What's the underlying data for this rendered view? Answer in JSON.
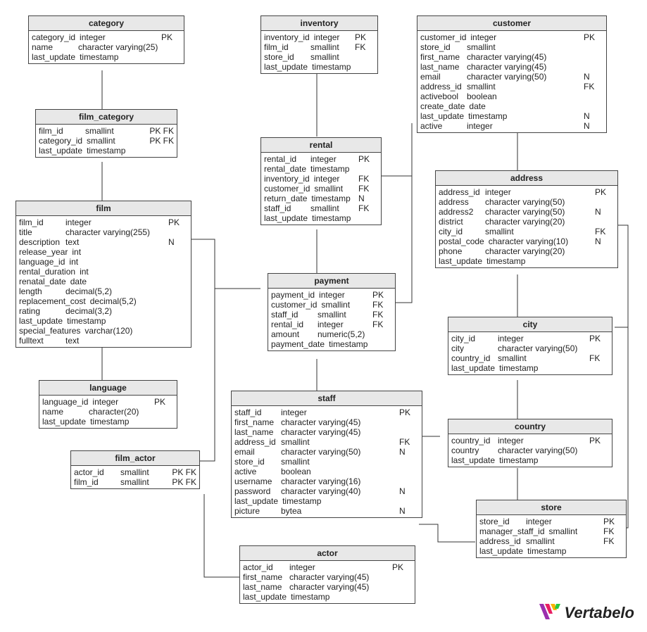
{
  "tables": {
    "category": {
      "title": "category",
      "cols": [
        {
          "n": "category_id",
          "t": "integer",
          "f": "PK"
        },
        {
          "n": "name",
          "t": "character varying(25)",
          "f": ""
        },
        {
          "n": "last_update",
          "t": "timestamp",
          "f": ""
        }
      ]
    },
    "film_category": {
      "title": "film_category",
      "cols": [
        {
          "n": "film_id",
          "t": "smallint",
          "f": "PK FK"
        },
        {
          "n": "category_id",
          "t": "smallint",
          "f": "PK FK"
        },
        {
          "n": "last_update",
          "t": "timestamp",
          "f": ""
        }
      ]
    },
    "film": {
      "title": "film",
      "cols": [
        {
          "n": "film_id",
          "t": "integer",
          "f": "PK"
        },
        {
          "n": "title",
          "t": "character varying(255)",
          "f": ""
        },
        {
          "n": "description",
          "t": "text",
          "f": "N"
        },
        {
          "n": "release_year",
          "t": "int",
          "f": ""
        },
        {
          "n": "language_id",
          "t": "int",
          "f": ""
        },
        {
          "n": "rental_duration",
          "t": "int",
          "f": ""
        },
        {
          "n": "renatal_date",
          "t": "date",
          "f": ""
        },
        {
          "n": "length",
          "t": "decimal(5,2)",
          "f": ""
        },
        {
          "n": "replacement_cost",
          "t": "decimal(5,2)",
          "f": ""
        },
        {
          "n": "rating",
          "t": "decimal(3,2)",
          "f": ""
        },
        {
          "n": "last_update",
          "t": "timestamp",
          "f": ""
        },
        {
          "n": "special_features",
          "t": "varchar(120)",
          "f": ""
        },
        {
          "n": "fulltext",
          "t": "text",
          "f": ""
        }
      ]
    },
    "language": {
      "title": "language",
      "cols": [
        {
          "n": "language_id",
          "t": "integer",
          "f": "PK"
        },
        {
          "n": "name",
          "t": "character(20)",
          "f": ""
        },
        {
          "n": "last_update",
          "t": "timestamp",
          "f": ""
        }
      ]
    },
    "film_actor": {
      "title": "film_actor",
      "cols": [
        {
          "n": "actor_id",
          "t": "smallint",
          "f": "PK FK"
        },
        {
          "n": "film_id",
          "t": "smallint",
          "f": "PK FK"
        }
      ]
    },
    "inventory": {
      "title": "inventory",
      "cols": [
        {
          "n": "inventory_id",
          "t": "integer",
          "f": "PK"
        },
        {
          "n": "film_id",
          "t": "smallint",
          "f": "FK"
        },
        {
          "n": "store_id",
          "t": "smallint",
          "f": ""
        },
        {
          "n": "last_update",
          "t": "timestamp",
          "f": ""
        }
      ]
    },
    "rental": {
      "title": "rental",
      "cols": [
        {
          "n": "rental_id",
          "t": "integer",
          "f": "PK"
        },
        {
          "n": "rental_date",
          "t": "timestamp",
          "f": ""
        },
        {
          "n": "inventory_id",
          "t": "integer",
          "f": "FK"
        },
        {
          "n": "customer_id",
          "t": "smallint",
          "f": "FK"
        },
        {
          "n": "return_date",
          "t": "timestamp",
          "f": "N"
        },
        {
          "n": "staff_id",
          "t": "smallint",
          "f": "FK"
        },
        {
          "n": "last_update",
          "t": "timestamp",
          "f": ""
        }
      ]
    },
    "payment": {
      "title": "payment",
      "cols": [
        {
          "n": "payment_id",
          "t": "integer",
          "f": "PK"
        },
        {
          "n": "customer_id",
          "t": "smallint",
          "f": "FK"
        },
        {
          "n": "staff_id",
          "t": "smallint",
          "f": "FK"
        },
        {
          "n": "rental_id",
          "t": "integer",
          "f": "FK"
        },
        {
          "n": "amount",
          "t": "numeric(5,2)",
          "f": ""
        },
        {
          "n": "payment_date",
          "t": "timestamp",
          "f": ""
        }
      ]
    },
    "staff": {
      "title": "staff",
      "cols": [
        {
          "n": "staff_id",
          "t": "integer",
          "f": "PK"
        },
        {
          "n": "first_name",
          "t": "character varying(45)",
          "f": ""
        },
        {
          "n": "last_name",
          "t": "character varying(45)",
          "f": ""
        },
        {
          "n": "address_id",
          "t": "smallint",
          "f": "FK"
        },
        {
          "n": "email",
          "t": "character varying(50)",
          "f": "N"
        },
        {
          "n": "store_id",
          "t": "smallint",
          "f": ""
        },
        {
          "n": "active",
          "t": "boolean",
          "f": ""
        },
        {
          "n": "username",
          "t": "character varying(16)",
          "f": ""
        },
        {
          "n": "password",
          "t": "character varying(40)",
          "f": "N"
        },
        {
          "n": "last_update",
          "t": "timestamp",
          "f": ""
        },
        {
          "n": "picture",
          "t": "bytea",
          "f": "N"
        }
      ]
    },
    "actor": {
      "title": "actor",
      "cols": [
        {
          "n": "actor_id",
          "t": "integer",
          "f": "PK"
        },
        {
          "n": "first_name",
          "t": "character varying(45)",
          "f": ""
        },
        {
          "n": "last_name",
          "t": "character varying(45)",
          "f": ""
        },
        {
          "n": "last_update",
          "t": "timestamp",
          "f": ""
        }
      ]
    },
    "customer": {
      "title": "customer",
      "cols": [
        {
          "n": "customer_id",
          "t": "integer",
          "f": "PK"
        },
        {
          "n": "store_id",
          "t": "smallint",
          "f": ""
        },
        {
          "n": "first_name",
          "t": "character varying(45)",
          "f": ""
        },
        {
          "n": "last_name",
          "t": "character varying(45)",
          "f": ""
        },
        {
          "n": "email",
          "t": "character varying(50)",
          "f": "N"
        },
        {
          "n": "address_id",
          "t": "smallint",
          "f": "FK"
        },
        {
          "n": "activebool",
          "t": "boolean",
          "f": ""
        },
        {
          "n": "create_date",
          "t": "date",
          "f": ""
        },
        {
          "n": "last_update",
          "t": "timestamp",
          "f": "N"
        },
        {
          "n": "active",
          "t": "integer",
          "f": "N"
        }
      ]
    },
    "address": {
      "title": "address",
      "cols": [
        {
          "n": "address_id",
          "t": "integer",
          "f": "PK"
        },
        {
          "n": "address",
          "t": "character varying(50)",
          "f": ""
        },
        {
          "n": "address2",
          "t": "character varying(50)",
          "f": "N"
        },
        {
          "n": "district",
          "t": "character varying(20)",
          "f": ""
        },
        {
          "n": "city_id",
          "t": "smallint",
          "f": "FK"
        },
        {
          "n": "postal_code",
          "t": "character varying(10)",
          "f": "N"
        },
        {
          "n": "phone",
          "t": "character varying(20)",
          "f": ""
        },
        {
          "n": "last_update",
          "t": "timestamp",
          "f": ""
        }
      ]
    },
    "city": {
      "title": "city",
      "cols": [
        {
          "n": "city_id",
          "t": "integer",
          "f": "PK"
        },
        {
          "n": "city",
          "t": "character varying(50)",
          "f": ""
        },
        {
          "n": "country_id",
          "t": "smallint",
          "f": "FK"
        },
        {
          "n": "last_update",
          "t": "timestamp",
          "f": ""
        }
      ]
    },
    "country": {
      "title": "country",
      "cols": [
        {
          "n": "country_id",
          "t": "integer",
          "f": "PK"
        },
        {
          "n": "country",
          "t": "character varying(50)",
          "f": ""
        },
        {
          "n": "last_update",
          "t": "timestamp",
          "f": ""
        }
      ]
    },
    "store": {
      "title": "store",
      "cols": [
        {
          "n": "store_id",
          "t": "integer",
          "f": "PK"
        },
        {
          "n": "manager_staff_id",
          "t": "smallint",
          "f": "FK"
        },
        {
          "n": "address_id",
          "t": "smallint",
          "f": "FK"
        },
        {
          "n": "last_update",
          "t": "timestamp",
          "f": ""
        }
      ]
    }
  },
  "logo_text": "Vertabelo"
}
